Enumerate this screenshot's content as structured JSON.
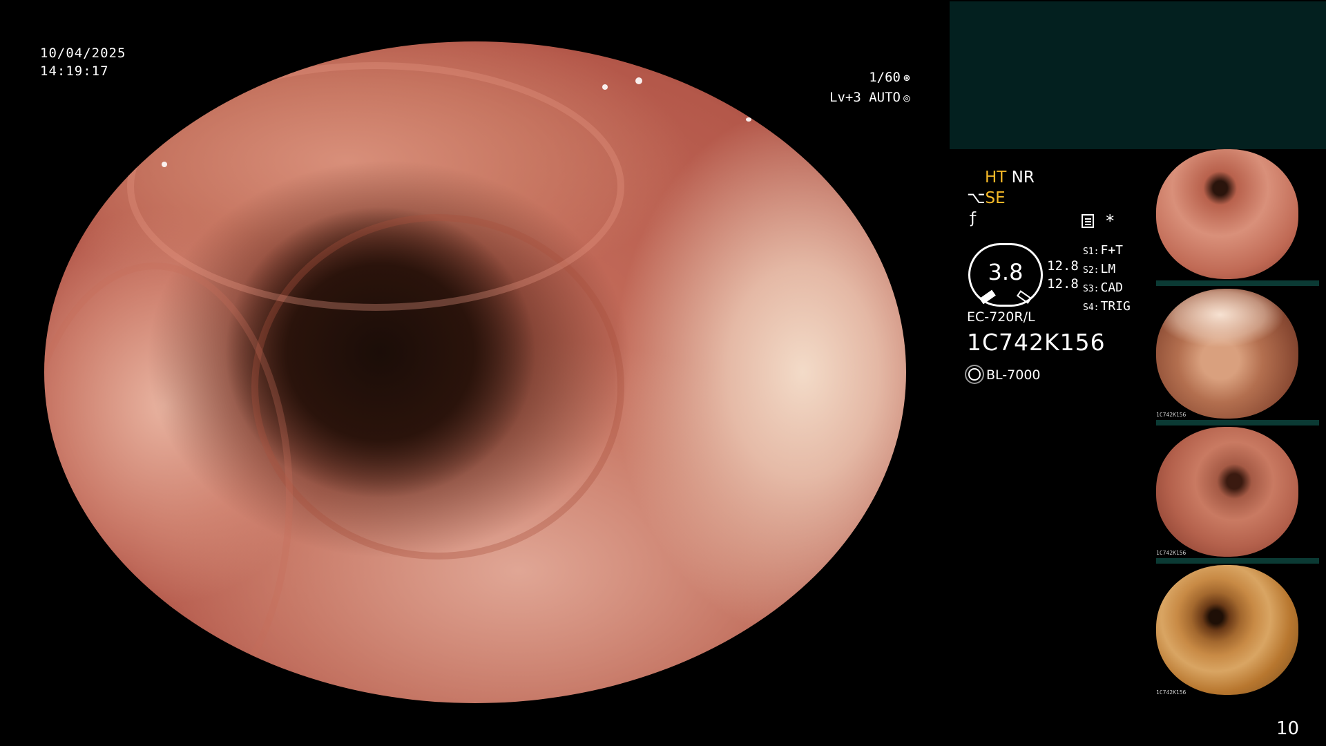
{
  "overlay": {
    "date": "10/04/2025",
    "time": "14:19:17",
    "shutter": "1/60",
    "level": "Lv+3",
    "exposure_mode": "AUTO"
  },
  "info_panel": {
    "enhancement_ht": "HT",
    "enhancement_nr": "NR",
    "structure_mode": "SE",
    "gauge_value": "3.8",
    "rate_1": "12.8",
    "rate_2": "12.8",
    "switches": [
      {
        "slot": "S1:",
        "label": "F+T"
      },
      {
        "slot": "S2:",
        "label": "LM"
      },
      {
        "slot": "S3:",
        "label": "CAD"
      },
      {
        "slot": "S4:",
        "label": "TRIG"
      }
    ],
    "scope_model": "EC-720R/L",
    "scope_serial": "1C742K156",
    "light_source": "BL-7000"
  },
  "thumbnails": {
    "caption": "1C742K156"
  },
  "page_number": "10",
  "colors": {
    "accent_yellow": "#f5b928",
    "panel_teal": "#03201f",
    "background": "#000000"
  },
  "icons": {
    "shutter": "shutter-icon",
    "auto": "auto-exposure-icon",
    "memo": "memo-icon",
    "light": "light-source-icon"
  }
}
